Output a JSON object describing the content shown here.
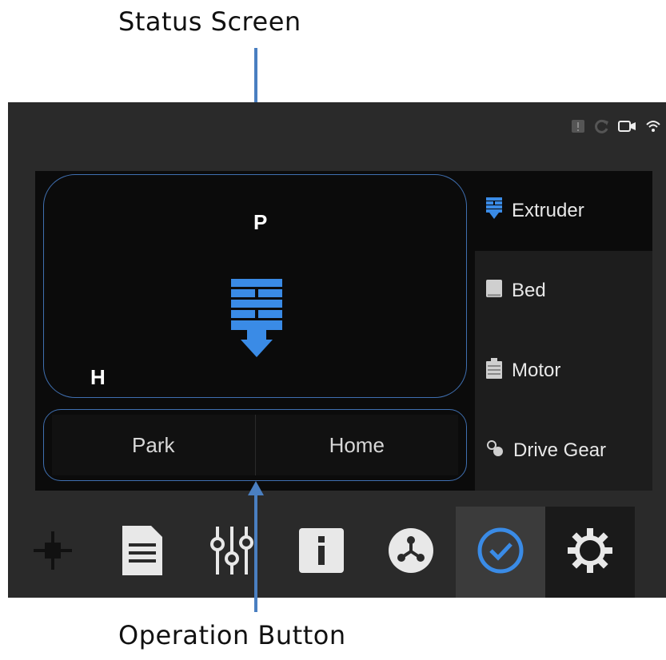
{
  "callouts": {
    "top": "Status Screen",
    "bottom": "Operation Button"
  },
  "status_screen": {
    "label_p": "P",
    "label_h": "H",
    "center_icon": "extruder-icon"
  },
  "operation_buttons": [
    {
      "label": "Park"
    },
    {
      "label": "Home"
    }
  ],
  "side_menu": [
    {
      "label": "Extruder",
      "icon": "extruder-icon",
      "active": true
    },
    {
      "label": "Bed",
      "icon": "bed-icon",
      "active": false
    },
    {
      "label": "Motor",
      "icon": "motor-icon",
      "active": false
    },
    {
      "label": "Drive Gear",
      "icon": "drive-gear-icon",
      "active": false
    }
  ],
  "status_icons": [
    "alert-icon",
    "refresh-icon",
    "camera-icon",
    "wifi-icon"
  ],
  "bottom_nav": [
    {
      "icon": "move-icon"
    },
    {
      "icon": "document-icon"
    },
    {
      "icon": "sliders-icon"
    },
    {
      "icon": "info-icon"
    },
    {
      "icon": "network-icon"
    },
    {
      "icon": "check-icon",
      "active": true
    },
    {
      "icon": "gear-icon"
    }
  ],
  "colors": {
    "accent": "#3a8be6",
    "callout_arrow": "#4a7fc1",
    "device_bg": "#2a2a2a",
    "panel_bg": "#0b0b0b"
  }
}
